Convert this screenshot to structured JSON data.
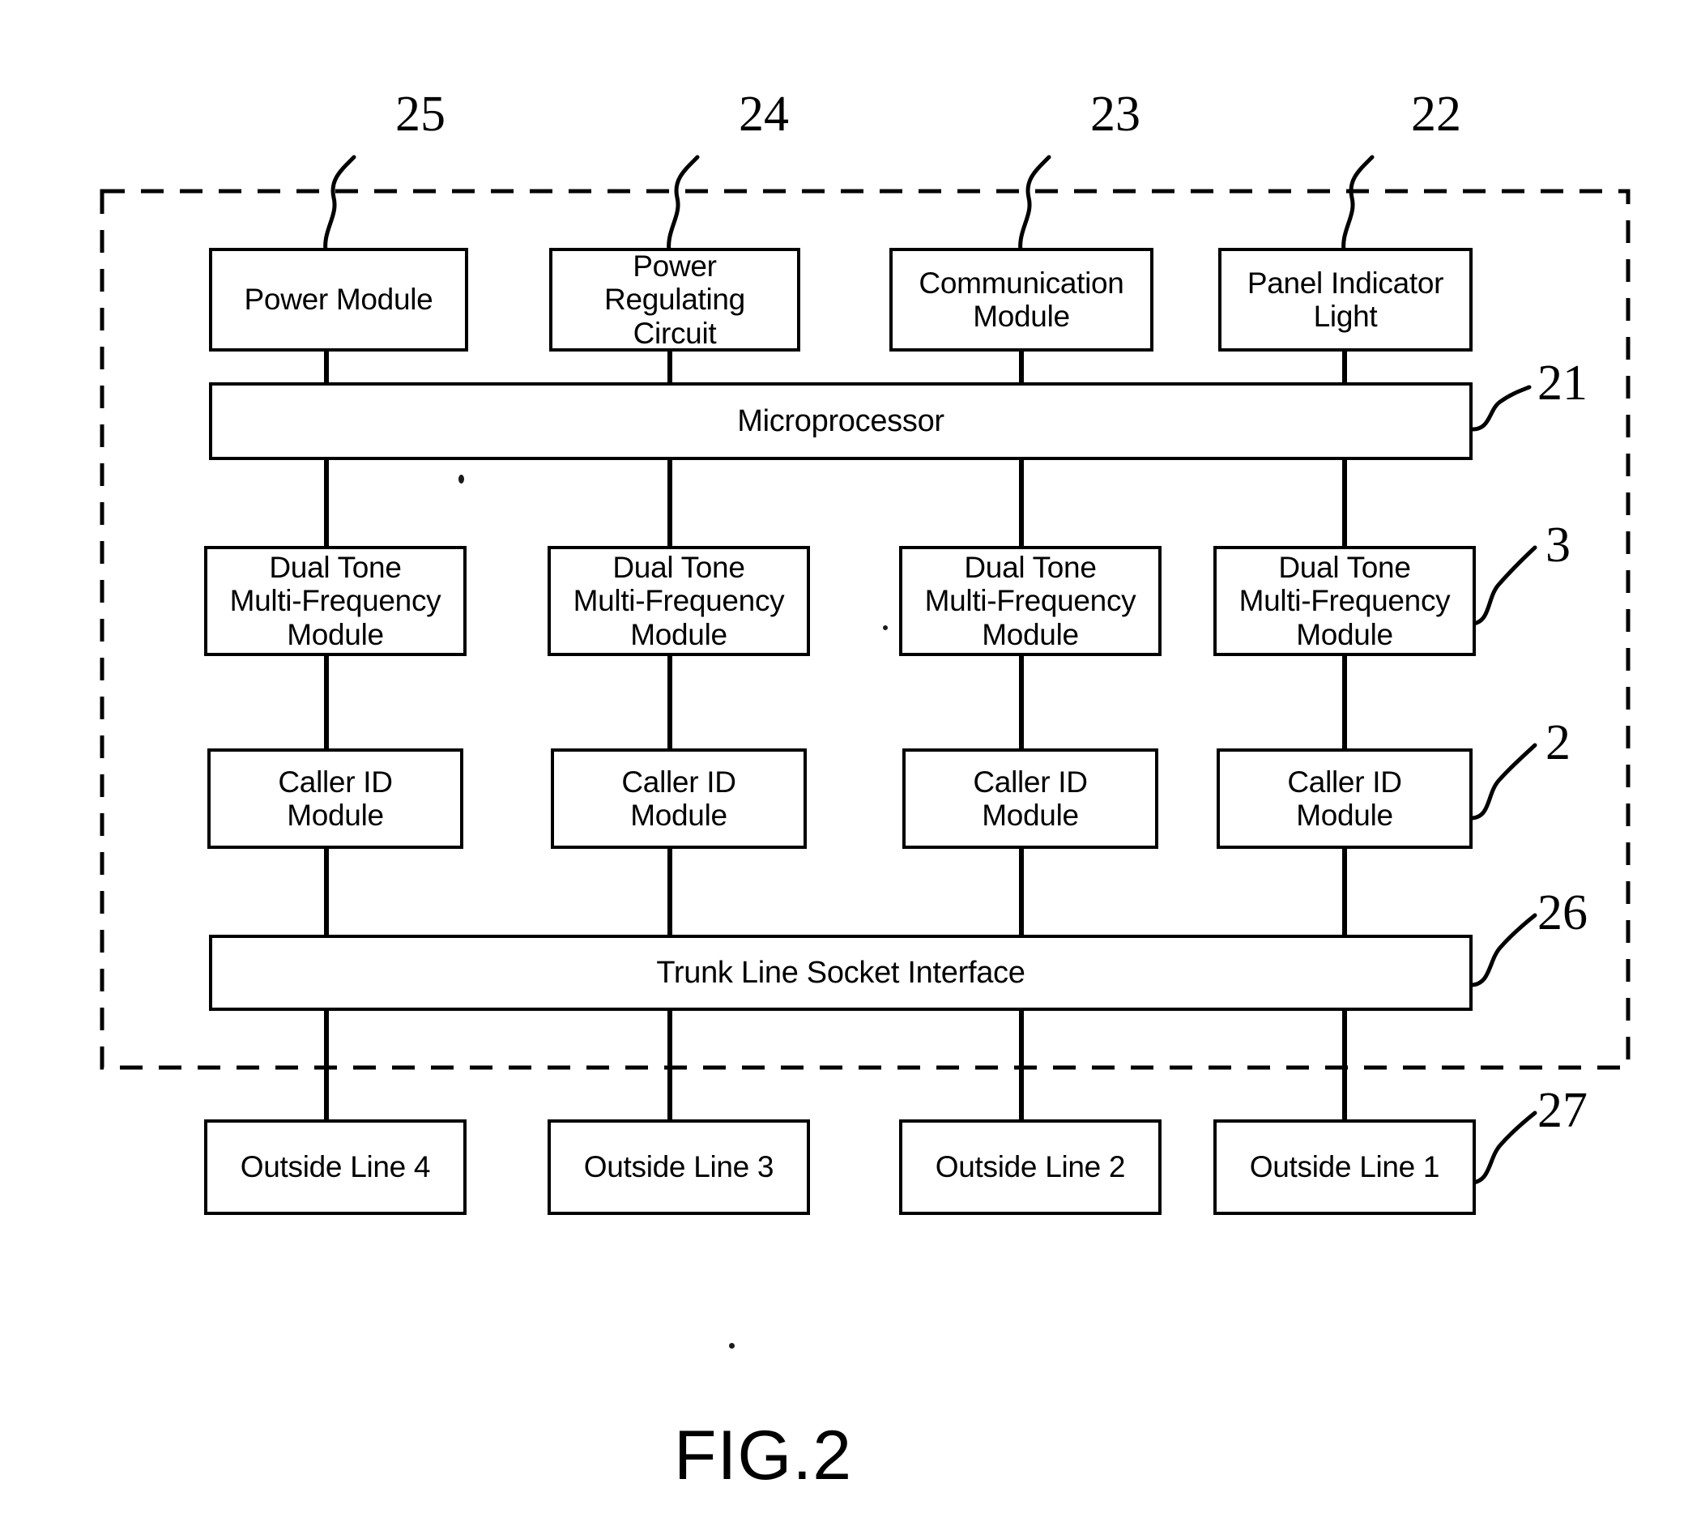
{
  "figure": {
    "caption": "FIG.2",
    "enclosure_label": "dashed-boundary"
  },
  "nodes": {
    "power_module": "Power Module",
    "power_regulating_circuit_l1": "Power",
    "power_regulating_circuit_l2": "Regulating",
    "power_regulating_circuit_l3": "Circuit",
    "communication_module_l1": "Communication",
    "communication_module_l2": "Module",
    "panel_indicator_light_l1": "Panel Indicator",
    "panel_indicator_light_l2": "Light",
    "microprocessor": "Microprocessor",
    "dtmf_l1": "Dual Tone",
    "dtmf_l2": "Multi-Frequency",
    "dtmf_l3": "Module",
    "caller_id_l1": "Caller ID",
    "caller_id_l2": "Module",
    "trunk_line_socket_interface": "Trunk Line Socket Interface",
    "outside_line_4": "Outside Line 4",
    "outside_line_3": "Outside Line 3",
    "outside_line_2": "Outside Line 2",
    "outside_line_1": "Outside Line 1"
  },
  "reference_numerals": {
    "power_module": "25",
    "power_regulating_circuit": "24",
    "communication_module": "23",
    "panel_indicator_light": "22",
    "microprocessor": "21",
    "dtmf_module": "3",
    "caller_id_module": "2",
    "trunk_line_socket_interface": "26",
    "outside_line": "27"
  },
  "colors": {
    "stroke": "#000000",
    "background": "#ffffff"
  }
}
